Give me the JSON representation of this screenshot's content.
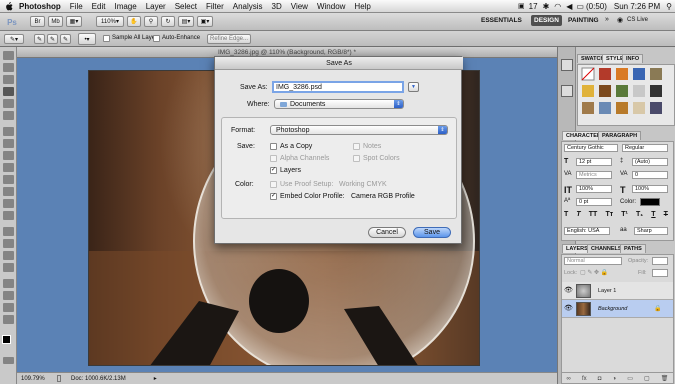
{
  "menubar": {
    "app_name": "Photoshop",
    "items": [
      "File",
      "Edit",
      "Image",
      "Layer",
      "Select",
      "Filter",
      "Analysis",
      "3D",
      "View",
      "Window",
      "Help"
    ],
    "status": {
      "adobe_badge": "17",
      "battery": "(0:50)",
      "clock": "Sun 7:26 PM"
    }
  },
  "appbar": {
    "ps_logo": "Ps",
    "zoom": "110%",
    "workspaces": [
      "ESSENTIALS",
      "DESIGN",
      "PAINTING"
    ],
    "workspaces_more": "»",
    "cs_live": "CS Live"
  },
  "options": {
    "sample_all_layers": "Sample All Layers",
    "auto_enhance": "Auto-Enhance",
    "refine_edge": "Refine Edge..."
  },
  "document": {
    "tab_title": "IMG_3286.jpg @ 110% (Background, RGB/8*) *",
    "zoom": "109.79%",
    "doc_size": "Doc: 1000.6K/2.13M"
  },
  "dialog": {
    "title": "Save As",
    "save_as_label": "Save As:",
    "save_as_value": "IMG_3286.psd",
    "where_label": "Where:",
    "where_value": "Documents",
    "format_label": "Format:",
    "format_value": "Photoshop",
    "save_label": "Save:",
    "options": {
      "as_a_copy": "As a Copy",
      "notes": "Notes",
      "alpha_channels": "Alpha Channels",
      "spot_colors": "Spot Colors",
      "layers": "Layers"
    },
    "color_label": "Color:",
    "use_proof_setup": "Use Proof Setup:",
    "proof_profile": "Working CMYK",
    "embed_color_profile": "Embed Color Profile:",
    "embed_profile": "Camera RGB Profile",
    "cancel": "Cancel",
    "save": "Save"
  },
  "panels": {
    "top_tabs": [
      "SWATCHES",
      "STYLES",
      "INFO"
    ],
    "char_tabs": [
      "CHARACTER",
      "PARAGRAPH"
    ],
    "font_family": "Century Gothic",
    "font_style": "Regular",
    "font_size": "12 pt",
    "leading": "(Auto)",
    "kerning": "Metrics",
    "tracking": "0",
    "vscale": "100%",
    "hscale": "100%",
    "baseline": "0 pt",
    "color_label": "Color:",
    "language": "English: USA",
    "antialias": "Sharp",
    "layer_tabs": [
      "LAYERS",
      "CHANNELS",
      "PATHS"
    ],
    "blend_mode": "Normal",
    "opacity_label": "Opacity:",
    "lock_label": "Lock:",
    "fill_label": "Fill:",
    "layers": [
      "Layer 1",
      "Background"
    ]
  },
  "colors": {
    "accent": "#3d6fc8",
    "canvas_bg": "#5b82b5",
    "selected_layer": "#b9cdf0"
  }
}
